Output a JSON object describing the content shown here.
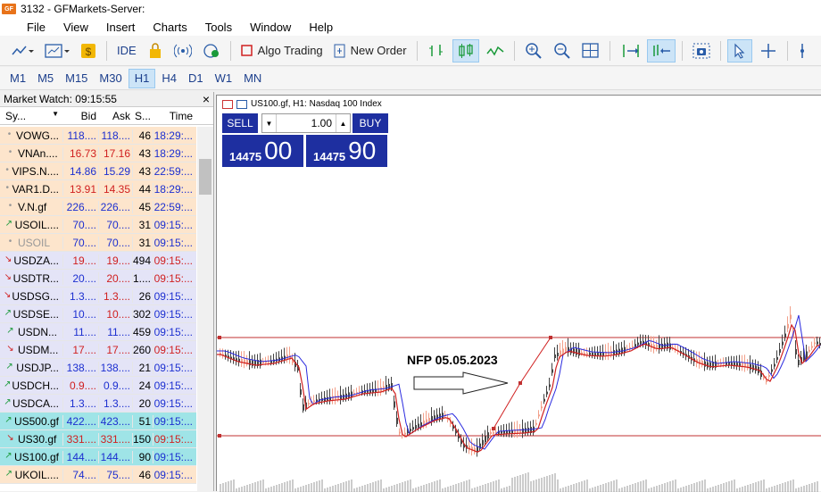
{
  "window": {
    "title": "3132 - GFMarkets-Server:",
    "logo_text": "GF"
  },
  "menu": [
    "File",
    "View",
    "Insert",
    "Charts",
    "Tools",
    "Window",
    "Help"
  ],
  "toolbar": {
    "ide_label": "IDE",
    "algo_label": "Algo Trading",
    "new_order_label": "New Order"
  },
  "timeframes": {
    "items": [
      "M1",
      "M5",
      "M15",
      "M30",
      "H1",
      "H4",
      "D1",
      "W1",
      "MN"
    ],
    "active": "H1"
  },
  "market_watch": {
    "title": "Market Watch: 09:15:55",
    "close_label": "×",
    "columns": [
      "Sy...",
      "Bid",
      "Ask",
      "S...",
      "Time"
    ],
    "rows": [
      {
        "dir": "dot",
        "symbol": "VOWG...",
        "bid": "118....",
        "ask": "118....",
        "spread": "46",
        "time": "18:29:...",
        "bg": "#fde5cc",
        "bid_color": "blue",
        "ask_color": "blue",
        "time_color": "blue"
      },
      {
        "dir": "dot",
        "symbol": "VNAn....",
        "bid": "16.73",
        "ask": "17.16",
        "spread": "43",
        "time": "18:29:...",
        "bg": "#fde5cc",
        "bid_color": "red",
        "ask_color": "red",
        "time_color": "blue"
      },
      {
        "dir": "dot",
        "symbol": "VIPS.N....",
        "bid": "14.86",
        "ask": "15.29",
        "spread": "43",
        "time": "22:59:...",
        "bg": "#fde5cc",
        "bid_color": "blue",
        "ask_color": "blue",
        "time_color": "blue"
      },
      {
        "dir": "dot",
        "symbol": "VAR1.D...",
        "bid": "13.91",
        "ask": "14.35",
        "spread": "44",
        "time": "18:29:...",
        "bg": "#fde5cc",
        "bid_color": "red",
        "ask_color": "red",
        "time_color": "blue"
      },
      {
        "dir": "dot",
        "symbol": "V.N.gf",
        "bid": "226....",
        "ask": "226....",
        "spread": "45",
        "time": "22:59:...",
        "bg": "#fde5cc",
        "bid_color": "blue",
        "ask_color": "blue",
        "time_color": "blue"
      },
      {
        "dir": "up",
        "symbol": "USOIL....",
        "bid": "70....",
        "ask": "70....",
        "spread": "31",
        "time": "09:15:...",
        "bg": "#fde5cc",
        "bid_color": "blue",
        "ask_color": "blue",
        "time_color": "blue"
      },
      {
        "dir": "dot",
        "symbol": "USOIL",
        "bid": "70....",
        "ask": "70....",
        "spread": "31",
        "time": "09:15:...",
        "bg": "#fde5cc",
        "bid_color": "blue",
        "ask_color": "blue",
        "time_color": "blue",
        "muted": true
      },
      {
        "dir": "down",
        "symbol": "USDZA...",
        "bid": "19....",
        "ask": "19....",
        "spread": "494",
        "time": "09:15:...",
        "bg": "#e4e4f7",
        "bid_color": "red",
        "ask_color": "red",
        "time_color": "red"
      },
      {
        "dir": "down",
        "symbol": "USDTR...",
        "bid": "20....",
        "ask": "20....",
        "spread": "1....",
        "time": "09:15:...",
        "bg": "#e4e4f7",
        "bid_color": "blue",
        "ask_color": "red",
        "time_color": "red"
      },
      {
        "dir": "down",
        "symbol": "USDSG...",
        "bid": "1.3....",
        "ask": "1.3....",
        "spread": "26",
        "time": "09:15:...",
        "bg": "#e4e4f7",
        "bid_color": "blue",
        "ask_color": "red",
        "time_color": "blue"
      },
      {
        "dir": "up",
        "symbol": "USDSE...",
        "bid": "10....",
        "ask": "10....",
        "spread": "302",
        "time": "09:15:...",
        "bg": "#e4e4f7",
        "bid_color": "blue",
        "ask_color": "red",
        "time_color": "blue"
      },
      {
        "dir": "up",
        "symbol": "USDN...",
        "bid": "11....",
        "ask": "11....",
        "spread": "459",
        "time": "09:15:...",
        "bg": "#e4e4f7",
        "bid_color": "blue",
        "ask_color": "blue",
        "time_color": "blue"
      },
      {
        "dir": "down",
        "symbol": "USDM...",
        "bid": "17....",
        "ask": "17....",
        "spread": "260",
        "time": "09:15:...",
        "bg": "#e4e4f7",
        "bid_color": "red",
        "ask_color": "red",
        "time_color": "red"
      },
      {
        "dir": "up",
        "symbol": "USDJP...",
        "bid": "138....",
        "ask": "138....",
        "spread": "21",
        "time": "09:15:...",
        "bg": "#e4e4f7",
        "bid_color": "blue",
        "ask_color": "blue",
        "time_color": "blue"
      },
      {
        "dir": "up",
        "symbol": "USDCH...",
        "bid": "0.9....",
        "ask": "0.9....",
        "spread": "24",
        "time": "09:15:...",
        "bg": "#e4e4f7",
        "bid_color": "red",
        "ask_color": "blue",
        "time_color": "blue"
      },
      {
        "dir": "up",
        "symbol": "USDCA...",
        "bid": "1.3....",
        "ask": "1.3....",
        "spread": "20",
        "time": "09:15:...",
        "bg": "#e4e4f7",
        "bid_color": "blue",
        "ask_color": "blue",
        "time_color": "blue"
      },
      {
        "dir": "up",
        "symbol": "US500.gf",
        "bid": "422....",
        "ask": "423....",
        "spread": "51",
        "time": "09:15:...",
        "bg": "#9fe4e7",
        "bid_color": "blue",
        "ask_color": "blue",
        "time_color": "blue"
      },
      {
        "dir": "down",
        "symbol": "US30.gf",
        "bid": "331....",
        "ask": "331....",
        "spread": "150",
        "time": "09:15:...",
        "bg": "#9fe4e7",
        "bid_color": "red",
        "ask_color": "red",
        "time_color": "red"
      },
      {
        "dir": "up",
        "symbol": "US100.gf",
        "bid": "144....",
        "ask": "144....",
        "spread": "90",
        "time": "09:15:...",
        "bg": "#9fe4e7",
        "bid_color": "blue",
        "ask_color": "blue",
        "time_color": "blue"
      },
      {
        "dir": "up",
        "symbol": "UKOIL....",
        "bid": "74....",
        "ask": "75....",
        "spread": "46",
        "time": "09:15:...",
        "bg": "#fde5cc",
        "bid_color": "blue",
        "ask_color": "blue",
        "time_color": "blue"
      }
    ]
  },
  "chart": {
    "header": "US100.gf, H1:  Nasdaq 100 Index",
    "sell_label": "SELL",
    "buy_label": "BUY",
    "lot": "1.00",
    "sell_price_small": "14475",
    "sell_price_big": "00",
    "buy_price_small": "14475",
    "buy_price_big": "90",
    "annotation": "NFP 05.05.2023"
  }
}
